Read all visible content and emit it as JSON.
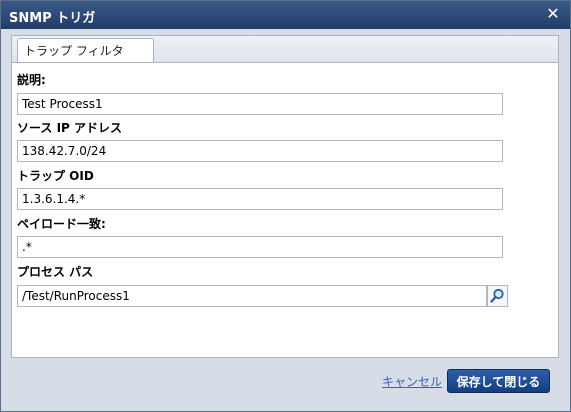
{
  "window": {
    "title": "SNMP トリガ",
    "close_label": "✕"
  },
  "tabs": [
    {
      "label": "トラップ フィルタ"
    }
  ],
  "form": {
    "description": {
      "label": "説明:",
      "value": "Test Process1"
    },
    "source_ip": {
      "label": "ソース IP アドレス",
      "value": "138.42.7.0/24"
    },
    "trap_oid": {
      "label": "トラップ OID",
      "value": "1.3.6.1.4.*"
    },
    "payload_match": {
      "label": "ペイロード一致:",
      "value": ".*"
    },
    "process_path": {
      "label": "プロセス パス",
      "value": "/Test/RunProcess1"
    }
  },
  "footer": {
    "cancel_label": "キャンセル",
    "save_close_label": "保存して閉じる"
  },
  "colors": {
    "titlebar": "#1f3d68",
    "primary_button": "#173f7e",
    "link": "#3a64b0"
  }
}
